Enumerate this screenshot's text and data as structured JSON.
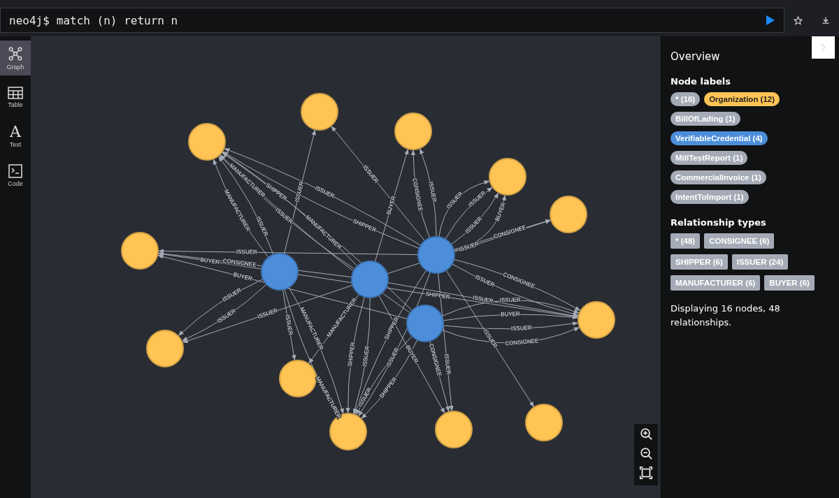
{
  "query": {
    "prompt": "neo4j$",
    "text": "match (n) return n"
  },
  "sidebar": [
    {
      "label": "Graph",
      "selected": true,
      "kind": "graph"
    },
    {
      "label": "Table",
      "selected": false,
      "kind": "table"
    },
    {
      "label": "Text",
      "selected": false,
      "kind": "text",
      "glyph": "A"
    },
    {
      "label": "Code",
      "selected": false,
      "kind": "code"
    }
  ],
  "overview": {
    "title": "Overview",
    "node_labels_heading": "Node labels",
    "node_labels": [
      {
        "text": "* (16)",
        "color": "#a5abb6"
      },
      {
        "text": "Organization (12)",
        "color": "#ffc454"
      },
      {
        "text": "BillOfLading (1)",
        "color": "#a5abb6"
      },
      {
        "text": "VerifiableCredential (4)",
        "color": "#4c8eda"
      },
      {
        "text": "MillTestReport (1)",
        "color": "#a5abb6"
      },
      {
        "text": "CommercialInvoice (1)",
        "color": "#a5abb6"
      },
      {
        "text": "IntentToImport (1)",
        "color": "#a5abb6"
      }
    ],
    "relationship_types_heading": "Relationship types",
    "relationship_types": [
      "* (48)",
      "CONSIGNEE (6)",
      "SHIPPER (6)",
      "ISSUER (24)",
      "MANUFACTURER (6)",
      "BUYER (6)"
    ],
    "summary": "Displaying 16 nodes, 48 relationships."
  },
  "graph": {
    "nodes": [
      {
        "color": "#ffc454"
      },
      {
        "color": "#ffc454"
      },
      {
        "color": "#ffc454"
      },
      {
        "color": "#ffc454"
      },
      {
        "color": "#ffc454"
      },
      {
        "color": "#ffc454"
      },
      {
        "color": "#ffc454"
      },
      {
        "color": "#ffc454"
      },
      {
        "color": "#ffc454"
      },
      {
        "color": "#ffc454"
      },
      {
        "color": "#ffc454"
      },
      {
        "color": "#ffc454"
      },
      {
        "color": "#4c8eda"
      },
      {
        "color": "#4c8eda"
      },
      {
        "color": "#4c8eda"
      },
      {
        "color": "#4c8eda"
      }
    ],
    "relationships": [
      {
        "label": "ISSUER"
      },
      {
        "label": "MANUFACTURER"
      },
      {
        "label": "ISSUER"
      },
      {
        "label": "BUYER"
      },
      {
        "label": "ISSUER"
      },
      {
        "label": "ISSUER"
      },
      {
        "label": "ISSUER"
      },
      {
        "label": "MANUFACTURER"
      },
      {
        "label": "MANUFACTURER"
      },
      {
        "label": "SHIPPER"
      },
      {
        "label": "ISSUER"
      },
      {
        "label": "MANUFACTURER"
      },
      {
        "label": "BUYER"
      },
      {
        "label": "ISSUER"
      },
      {
        "label": "ISSUER"
      },
      {
        "label": "SHIPPER"
      },
      {
        "label": "BUYER"
      },
      {
        "label": "ISSUER"
      },
      {
        "label": "ISSUER"
      },
      {
        "label": "CONSIGNEE"
      },
      {
        "label": "SHIPPER"
      },
      {
        "label": "ISSUER"
      },
      {
        "label": "ISSUER"
      },
      {
        "label": "CONSIGNEE"
      },
      {
        "label": "ISSUER"
      },
      {
        "label": "ISSUER"
      },
      {
        "label": "ISSUER"
      },
      {
        "label": "ISSUER"
      },
      {
        "label": "CONSIGNEE"
      },
      {
        "label": "BUYER"
      },
      {
        "label": "CONSIGNEE"
      },
      {
        "label": "ISSUER"
      },
      {
        "label": "ISSUER"
      },
      {
        "label": "SHIPPER"
      },
      {
        "label": "ISSUER"
      },
      {
        "label": "ISSUER"
      },
      {
        "label": "MANUFACTURER"
      },
      {
        "label": "SHIPPER"
      },
      {
        "label": "ISSUER"
      },
      {
        "label": "BUYER"
      },
      {
        "label": "ISSUER"
      },
      {
        "label": "CONSIGNEE"
      },
      {
        "label": "SHIPPER"
      },
      {
        "label": "ISSUER"
      },
      {
        "label": "CONSIGNEE"
      },
      {
        "label": "MANUFACTURER"
      },
      {
        "label": "BUYER"
      },
      {
        "label": "ISSUER"
      }
    ]
  }
}
